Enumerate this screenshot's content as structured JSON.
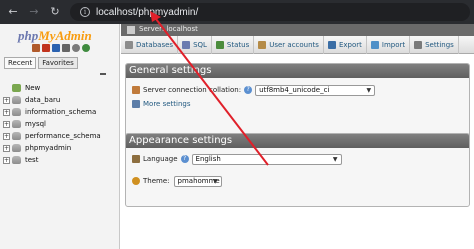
{
  "browser": {
    "back_icon": "arrow-left-icon",
    "forward_icon": "arrow-right-icon",
    "reload_icon": "reload-icon",
    "home_icon": "home-icon",
    "site_info_icon": "info-icon",
    "url": "localhost/phpmyadmin/"
  },
  "leftnav": {
    "logo_part1": "php",
    "logo_part2": "MyAdmin",
    "tabs": [
      "Recent",
      "Favorites"
    ],
    "tree": [
      "New",
      "data_baru",
      "information_schema",
      "mysql",
      "performance_schema",
      "phpmyadmin",
      "test"
    ]
  },
  "main": {
    "breadcrumb": "Server: localhost",
    "tabs": [
      "Databases",
      "SQL",
      "Status",
      "User accounts",
      "Export",
      "Import",
      "Settings"
    ],
    "general": {
      "title": "General settings",
      "collation_label": "Server connection collation:",
      "collation_value": "utf8mb4_unicode_ci",
      "more_settings": "More settings"
    },
    "appearance": {
      "title": "Appearance settings",
      "language_label": "Language",
      "language_value": "English",
      "theme_label": "Theme:",
      "theme_value": "pmahomme"
    }
  },
  "annotation_color": "#e0202a"
}
